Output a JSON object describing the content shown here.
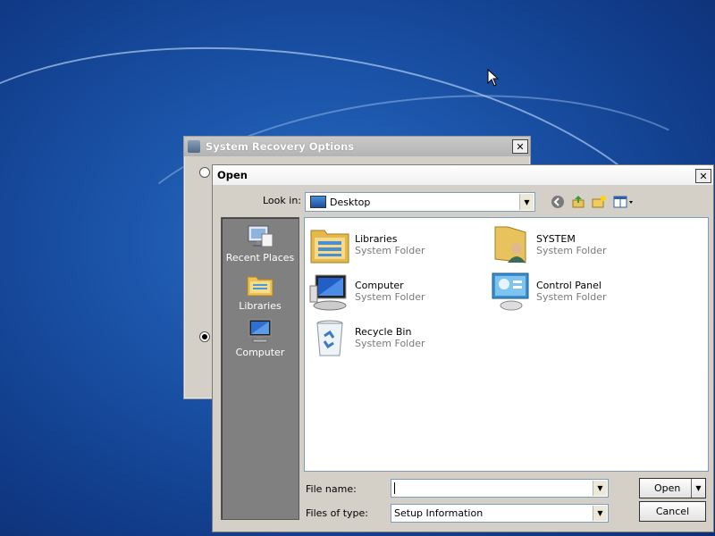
{
  "desktop": {},
  "recovery_window": {
    "title": "System Recovery Options",
    "close_glyph": "✕"
  },
  "open_dialog": {
    "title": "Open",
    "close_glyph": "✕",
    "look_in_label": "Look in:",
    "look_in_value": "Desktop",
    "toolbar_icons": [
      "back-icon",
      "up-folder-icon",
      "new-folder-icon",
      "views-menu-icon"
    ],
    "places": [
      {
        "label": "Recent Places",
        "icon": "recent-places-icon"
      },
      {
        "label": "Libraries",
        "icon": "libraries-icon"
      },
      {
        "label": "Computer",
        "icon": "computer-icon"
      }
    ],
    "items": [
      {
        "name": "Libraries",
        "type": "System Folder",
        "icon": "libraries-folder-icon"
      },
      {
        "name": "SYSTEM",
        "type": "System Folder",
        "icon": "user-folder-icon"
      },
      {
        "name": "Computer",
        "type": "System Folder",
        "icon": "computer-icon"
      },
      {
        "name": "Control Panel",
        "type": "System Folder",
        "icon": "control-panel-icon"
      },
      {
        "name": "Recycle Bin",
        "type": "System Folder",
        "icon": "recycle-bin-icon"
      }
    ],
    "file_name_label": "File name:",
    "file_name_value": "",
    "file_type_label": "Files of type:",
    "file_type_value": "Setup Information",
    "open_button": "Open",
    "cancel_button": "Cancel"
  }
}
